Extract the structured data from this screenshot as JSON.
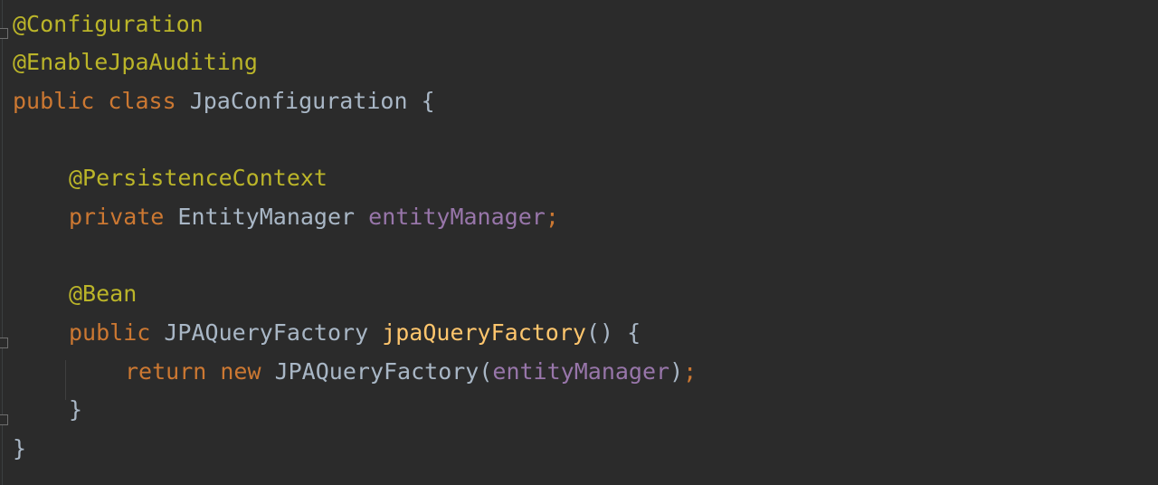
{
  "editor": {
    "theme_colors": {
      "background": "#2b2b2b",
      "annotation": "#bbb529",
      "keyword": "#cc7832",
      "identifier": "#a9b7c6",
      "field": "#9876aa",
      "method": "#ffc66d"
    },
    "lines": [
      {
        "tokens": [
          {
            "text": "@Configuration",
            "kind": "annotation"
          }
        ]
      },
      {
        "tokens": [
          {
            "text": "@EnableJpaAuditing",
            "kind": "annotation"
          }
        ]
      },
      {
        "tokens": [
          {
            "text": "public",
            "kind": "keyword"
          },
          {
            "text": " ",
            "kind": "space"
          },
          {
            "text": "class",
            "kind": "keyword"
          },
          {
            "text": " JpaConfiguration {",
            "kind": "identifier"
          }
        ]
      },
      {
        "tokens": []
      },
      {
        "tokens": [
          {
            "text": "@PersistenceContext",
            "kind": "annotation"
          }
        ]
      },
      {
        "tokens": [
          {
            "text": "private",
            "kind": "keyword"
          },
          {
            "text": " EntityManager ",
            "kind": "identifier"
          },
          {
            "text": "entityManager",
            "kind": "field"
          },
          {
            "text": ";",
            "kind": "semicolon"
          }
        ]
      },
      {
        "tokens": []
      },
      {
        "tokens": [
          {
            "text": "@Bean",
            "kind": "annotation"
          }
        ]
      },
      {
        "tokens": [
          {
            "text": "public",
            "kind": "keyword"
          },
          {
            "text": " JPAQueryFactory ",
            "kind": "identifier"
          },
          {
            "text": "jpaQueryFactory",
            "kind": "method"
          },
          {
            "text": "() {",
            "kind": "identifier"
          }
        ]
      },
      {
        "tokens": [
          {
            "text": "return",
            "kind": "keyword"
          },
          {
            "text": " ",
            "kind": "space"
          },
          {
            "text": "new",
            "kind": "keyword"
          },
          {
            "text": " JPAQueryFactory(",
            "kind": "identifier"
          },
          {
            "text": "entityManager",
            "kind": "field"
          },
          {
            "text": ")",
            "kind": "identifier"
          },
          {
            "text": ";",
            "kind": "semicolon"
          }
        ]
      },
      {
        "tokens": [
          {
            "text": "}",
            "kind": "identifier"
          }
        ]
      },
      {
        "tokens": [
          {
            "text": "}",
            "kind": "identifier"
          }
        ]
      }
    ]
  }
}
